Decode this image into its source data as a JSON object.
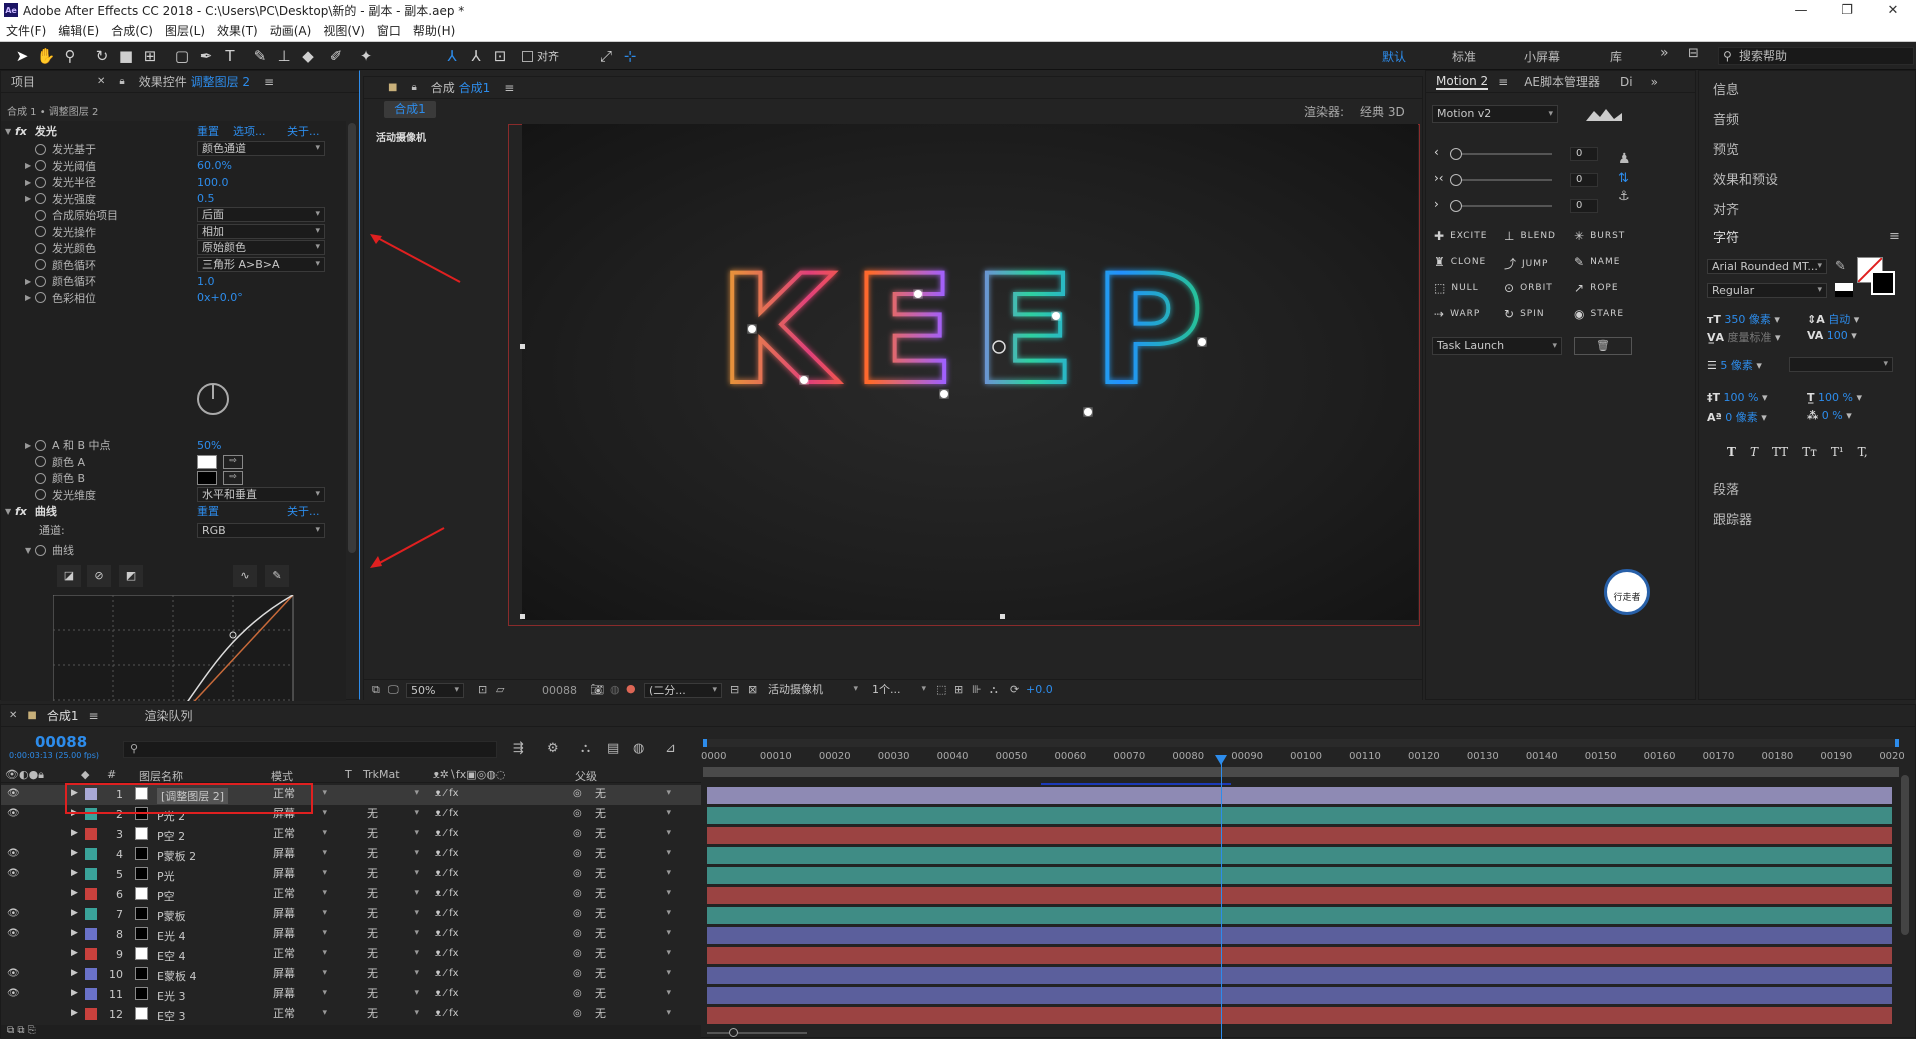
{
  "window": {
    "title": "Adobe After Effects CC 2018 - C:\\Users\\PC\\Desktop\\新的 - 副本 - 副本.aep *",
    "logo": "Ae"
  },
  "menu": [
    "文件(F)",
    "编辑(E)",
    "合成(C)",
    "图层(L)",
    "效果(T)",
    "动画(A)",
    "视图(V)",
    "窗口",
    "帮助(H)"
  ],
  "toolbar": {
    "snap_label": "对齐"
  },
  "workspaces": {
    "items": [
      "默认",
      "标准",
      "小屏幕",
      "库"
    ],
    "active": "默认",
    "search_placeholder": "搜索帮助"
  },
  "effects_panel": {
    "tab_project": "项目",
    "tab_effects_prefix": "效果控件",
    "tab_effects_layer": "调整图层 2",
    "breadcrumb": "合成 1 • 调整图层 2",
    "fx1": {
      "name": "发光",
      "reset": "重置",
      "options": "选项...",
      "about": "关于..."
    },
    "fx1_props": [
      {
        "label": "发光基于",
        "value": "颜色通道",
        "kind": "select"
      },
      {
        "label": "发光阈值",
        "value": "60.0%",
        "kind": "num"
      },
      {
        "label": "发光半径",
        "value": "100.0",
        "kind": "num"
      },
      {
        "label": "发光强度",
        "value": "0.5",
        "kind": "num"
      },
      {
        "label": "合成原始项目",
        "value": "后面",
        "kind": "select"
      },
      {
        "label": "发光操作",
        "value": "相加",
        "kind": "select"
      },
      {
        "label": "发光颜色",
        "value": "原始颜色",
        "kind": "select"
      },
      {
        "label": "颜色循环",
        "value": "三角形 A>B>A",
        "kind": "select"
      },
      {
        "label": "颜色循环",
        "value": "1.0",
        "kind": "num"
      },
      {
        "label": "色彩相位",
        "value": "0x+0.0°",
        "kind": "num"
      }
    ],
    "fx1_props2": [
      {
        "label": "A 和 B 中点",
        "value": "50%",
        "kind": "num"
      },
      {
        "label": "颜色 A",
        "value": "",
        "kind": "colorA"
      },
      {
        "label": "颜色 B",
        "value": "",
        "kind": "colorB"
      },
      {
        "label": "发光维度",
        "value": "水平和垂直",
        "kind": "select"
      }
    ],
    "fx2": {
      "name": "曲线",
      "reset": "重置",
      "about": "关于..."
    },
    "channel_label": "通道:",
    "channel_value": "RGB",
    "curve_label": "曲线"
  },
  "viewer": {
    "tab": "合成",
    "tab_name": "合成1",
    "comp_tag": "合成1",
    "renderer_label": "渲染器:",
    "renderer_value": "经典 3D",
    "camera_label": "活动摄像机",
    "canvas_text": "KEEP",
    "bottom": {
      "zoom": "50%",
      "timecode": "00088",
      "resolution": "(二分...",
      "camera": "活动摄像机",
      "views": "1个...",
      "exposure": "+0.0"
    }
  },
  "motion": {
    "tab1": "Motion 2",
    "tab2": "AE脚本管理器",
    "tab3": "Di",
    "preset": "Motion v2",
    "sliders": [
      {
        "value": "0",
        "fraction": 0
      },
      {
        "value": "0",
        "fraction": 0
      },
      {
        "value": "0",
        "fraction": 0
      }
    ],
    "buttons": [
      "EXCITE",
      "BLEND",
      "BURST",
      "CLONE",
      "JUMP",
      "NAME",
      "NULL",
      "ORBIT",
      "ROPE",
      "WARP",
      "SPIN",
      "STARE"
    ],
    "task": "Task Launch",
    "watermark": "行走者"
  },
  "right_panel": {
    "items": [
      "信息",
      "音频",
      "预览",
      "效果和预设",
      "对齐"
    ],
    "char_title": "字符",
    "font": "Arial Rounded MT...",
    "style": "Regular",
    "size": "350 像素",
    "leading": "自动",
    "kerning": "度量标准",
    "tracking": "100",
    "stroke": "5 像素",
    "vscale": "100 %",
    "hscale": "100 %",
    "baseline": "0 像素",
    "tsume": "0 %",
    "typo": [
      "T",
      "T",
      "TT",
      "Tт",
      "T¹",
      "T,"
    ],
    "para": "段落",
    "tracker": "跟踪器"
  },
  "timeline": {
    "tab": "合成1",
    "tab2": "渲染队列",
    "timecode": "00088",
    "timecode_sub": "0:00:03:13 (25.00 fps)",
    "headers": {
      "name": "图层名称",
      "mode": "模式",
      "t": "T",
      "trkmat": "TrkMat",
      "parent": "父级"
    },
    "ruler": [
      "0000",
      "00010",
      "00020",
      "00030",
      "00040",
      "00050",
      "00060",
      "00070",
      "00080",
      "00090",
      "00100",
      "00110",
      "00120",
      "00130",
      "00140",
      "00150",
      "00160",
      "00170",
      "00180",
      "00190",
      "0020"
    ],
    "playhead_frame": 88,
    "layers": [
      {
        "num": "1",
        "name": "[调整图层 2]",
        "mode": "正常",
        "trk": "",
        "parent": "无",
        "color": "#a9a9d6",
        "bar": "#8e8ab4",
        "eye": true
      },
      {
        "num": "2",
        "name": "P光 2",
        "mode": "屏幕",
        "trk": "无",
        "parent": "无",
        "color": "#3aa39a",
        "bar": "#3f8c85",
        "eye": true
      },
      {
        "num": "3",
        "name": "P空 2",
        "mode": "正常",
        "trk": "无",
        "parent": "无",
        "color": "#c9413d",
        "bar": "#9b4342",
        "eye": false
      },
      {
        "num": "4",
        "name": "P蒙板 2",
        "mode": "屏幕",
        "trk": "无",
        "parent": "无",
        "color": "#3aa39a",
        "bar": "#3f8c85",
        "eye": true
      },
      {
        "num": "5",
        "name": "P光",
        "mode": "屏幕",
        "trk": "无",
        "parent": "无",
        "color": "#3aa39a",
        "bar": "#3f8c85",
        "eye": true
      },
      {
        "num": "6",
        "name": "P空",
        "mode": "正常",
        "trk": "无",
        "parent": "无",
        "color": "#c9413d",
        "bar": "#9b4342",
        "eye": false
      },
      {
        "num": "7",
        "name": "P蒙板",
        "mode": "屏幕",
        "trk": "无",
        "parent": "无",
        "color": "#3aa39a",
        "bar": "#3f8c85",
        "eye": true
      },
      {
        "num": "8",
        "name": "E光 4",
        "mode": "屏幕",
        "trk": "无",
        "parent": "无",
        "color": "#6a72c9",
        "bar": "#5b5f9c",
        "eye": true
      },
      {
        "num": "9",
        "name": "E空 4",
        "mode": "正常",
        "trk": "无",
        "parent": "无",
        "color": "#c9413d",
        "bar": "#9b4342",
        "eye": false
      },
      {
        "num": "10",
        "name": "E蒙板 4",
        "mode": "屏幕",
        "trk": "无",
        "parent": "无",
        "color": "#6a72c9",
        "bar": "#5b5f9c",
        "eye": true
      },
      {
        "num": "11",
        "name": "E光 3",
        "mode": "屏幕",
        "trk": "无",
        "parent": "无",
        "color": "#6a72c9",
        "bar": "#5b5f9c",
        "eye": true
      },
      {
        "num": "12",
        "name": "E空 3",
        "mode": "正常",
        "trk": "无",
        "parent": "无",
        "color": "#c9413d",
        "bar": "#9b4342",
        "eye": false
      }
    ]
  }
}
